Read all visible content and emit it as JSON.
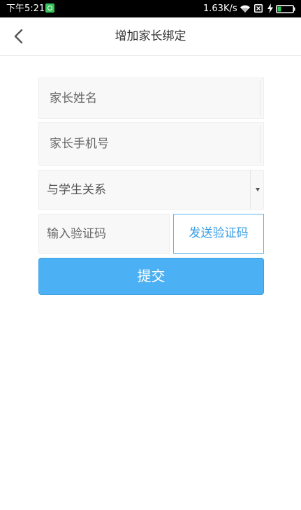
{
  "status_bar": {
    "time": "下午5:21",
    "network_speed": "1.63K/s",
    "icons": [
      "app-notification-icon",
      "wifi-icon",
      "sim-card-icon",
      "charging-bolt-icon",
      "battery-icon"
    ]
  },
  "header": {
    "title": "增加家长绑定",
    "back_icon": "chevron-left-icon"
  },
  "form": {
    "parent_name": {
      "placeholder": "家长姓名",
      "value": ""
    },
    "parent_phone": {
      "placeholder": "家长手机号",
      "value": ""
    },
    "relation": {
      "selected": "与学生关系"
    },
    "verification_code": {
      "placeholder": "输入验证码",
      "value": ""
    },
    "send_code_label": "发送验证码",
    "submit_label": "提交"
  },
  "colors": {
    "accent": "#4cb1f4",
    "accent_text": "#3a9fe6",
    "field_background": "#f8f8f8",
    "status_bar": "#000000"
  }
}
